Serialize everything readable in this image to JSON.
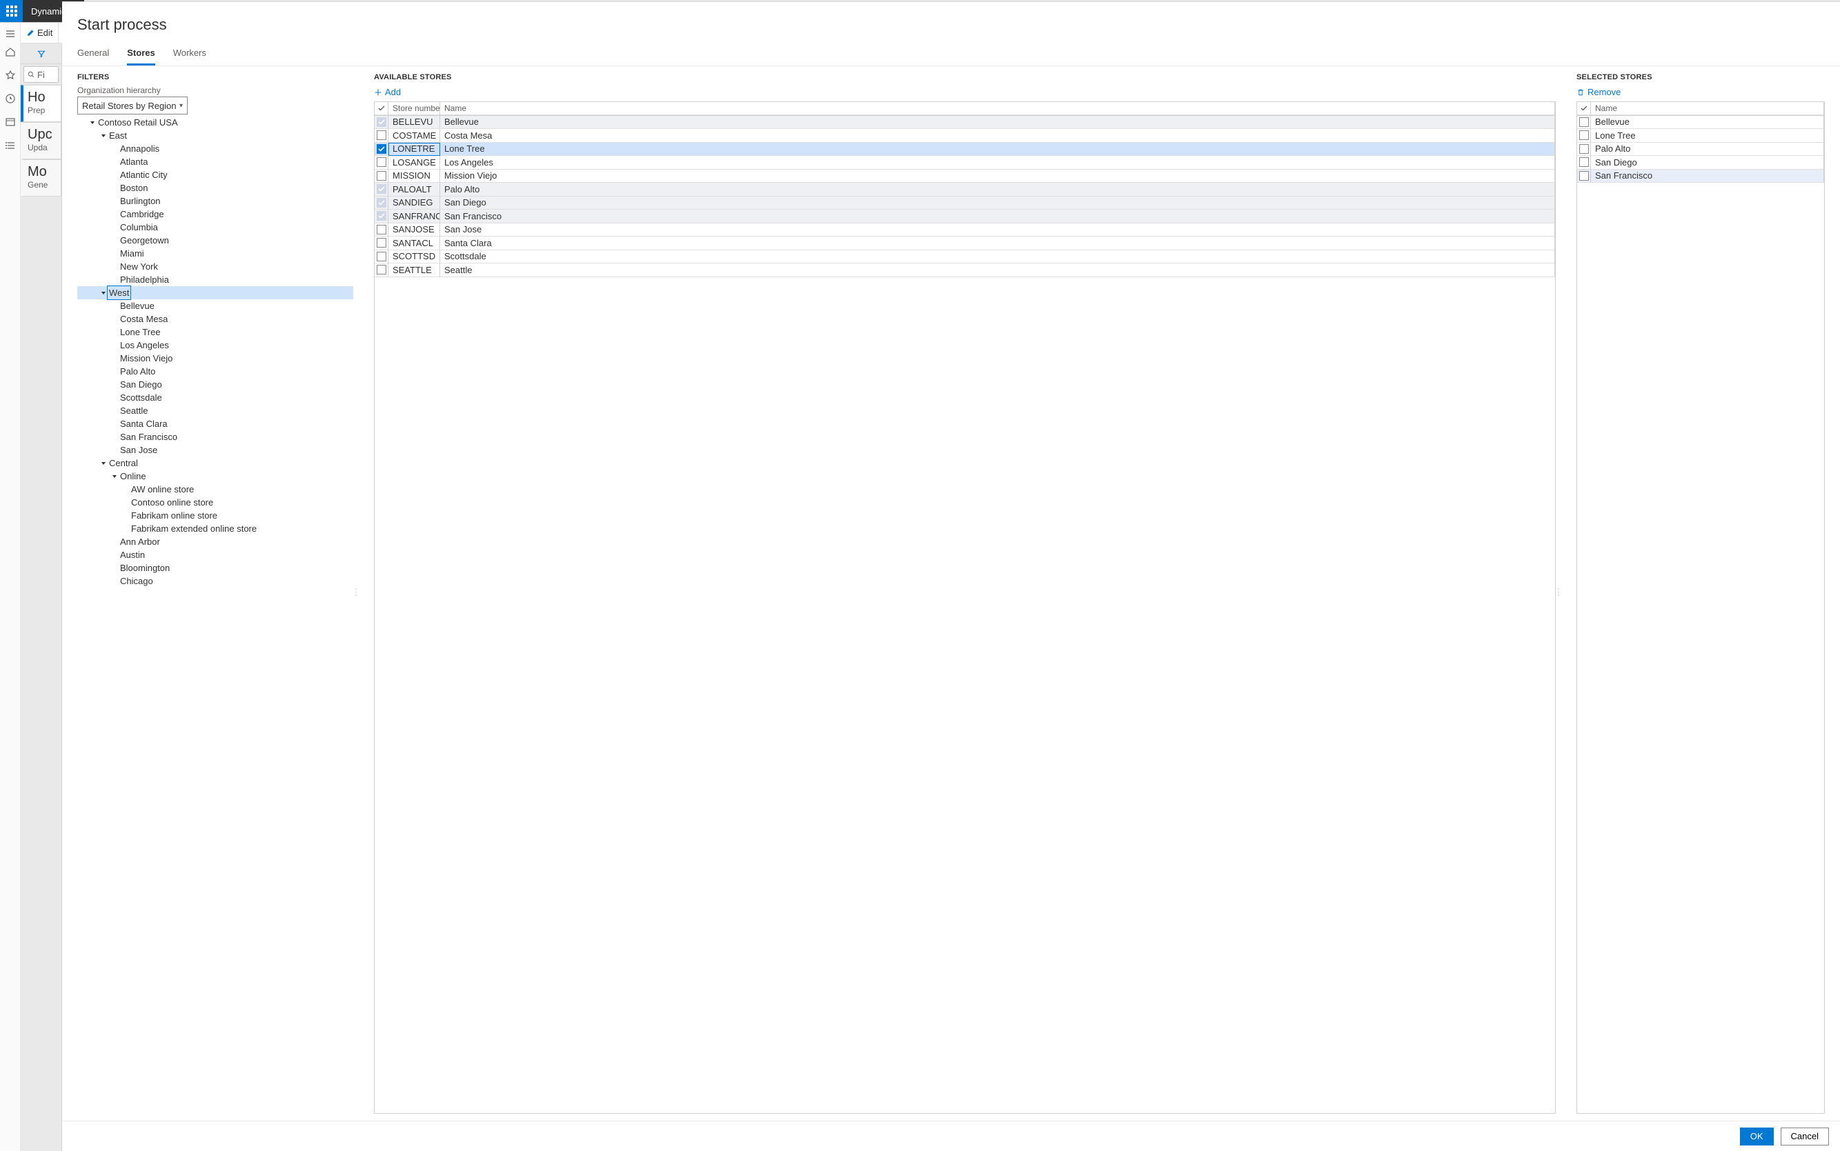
{
  "app": {
    "name": "Dynamics"
  },
  "toolbar": {
    "edit": "Edit"
  },
  "search": {
    "placeholder": "Fi"
  },
  "cards": [
    {
      "big": "Ho",
      "small": "Prep"
    },
    {
      "big": "Upc",
      "small": "Upda"
    },
    {
      "big": "Mo",
      "small": "Gene"
    }
  ],
  "dialog": {
    "title": "Start process",
    "tabs": {
      "general": "General",
      "stores": "Stores",
      "workers": "Workers"
    },
    "filters": {
      "heading": "FILTERS",
      "label": "Organization hierarchy",
      "value": "Retail Stores by Region"
    },
    "tree": [
      {
        "indent": 1,
        "expander": "down",
        "label": "Contoso Retail USA"
      },
      {
        "indent": 2,
        "expander": "down",
        "label": "East"
      },
      {
        "indent": 3,
        "label": "Annapolis"
      },
      {
        "indent": 3,
        "label": "Atlanta"
      },
      {
        "indent": 3,
        "label": "Atlantic City"
      },
      {
        "indent": 3,
        "label": "Boston"
      },
      {
        "indent": 3,
        "label": "Burlington"
      },
      {
        "indent": 3,
        "label": "Cambridge"
      },
      {
        "indent": 3,
        "label": "Columbia"
      },
      {
        "indent": 3,
        "label": "Georgetown"
      },
      {
        "indent": 3,
        "label": "Miami"
      },
      {
        "indent": 3,
        "label": "New York"
      },
      {
        "indent": 3,
        "label": "Philadelphia"
      },
      {
        "indent": 2,
        "expander": "down",
        "label": "West",
        "selected": true
      },
      {
        "indent": 3,
        "label": "Bellevue"
      },
      {
        "indent": 3,
        "label": "Costa Mesa"
      },
      {
        "indent": 3,
        "label": "Lone Tree"
      },
      {
        "indent": 3,
        "label": "Los Angeles"
      },
      {
        "indent": 3,
        "label": "Mission Viejo"
      },
      {
        "indent": 3,
        "label": "Palo Alto"
      },
      {
        "indent": 3,
        "label": "San Diego"
      },
      {
        "indent": 3,
        "label": "Scottsdale"
      },
      {
        "indent": 3,
        "label": "Seattle"
      },
      {
        "indent": 3,
        "label": "Santa Clara"
      },
      {
        "indent": 3,
        "label": "San Francisco"
      },
      {
        "indent": 3,
        "label": "San Jose"
      },
      {
        "indent": 2,
        "expander": "down",
        "label": "Central"
      },
      {
        "indent": 3,
        "expander": "down",
        "label": "Online"
      },
      {
        "indent": 4,
        "label": "AW online store"
      },
      {
        "indent": 4,
        "label": "Contoso online store"
      },
      {
        "indent": 4,
        "label": "Fabrikam online store"
      },
      {
        "indent": 4,
        "label": "Fabrikam extended online store"
      },
      {
        "indent": 3,
        "label": "Ann Arbor"
      },
      {
        "indent": 3,
        "label": "Austin"
      },
      {
        "indent": 3,
        "label": "Bloomington"
      },
      {
        "indent": 3,
        "label": "Chicago"
      }
    ],
    "available": {
      "heading": "AVAILABLE STORES",
      "add": "Add",
      "columns": {
        "number": "Store number",
        "name": "Name"
      },
      "rows": [
        {
          "num": "BELLEVU",
          "name": "Bellevue",
          "state": "soft"
        },
        {
          "num": "COSTAME",
          "name": "Costa Mesa",
          "state": ""
        },
        {
          "num": "LONETRE",
          "name": "Lone Tree",
          "state": "hard"
        },
        {
          "num": "LOSANGE",
          "name": "Los Angeles",
          "state": ""
        },
        {
          "num": "MISSION",
          "name": "Mission Viejo",
          "state": ""
        },
        {
          "num": "PALOALT",
          "name": "Palo Alto",
          "state": "soft"
        },
        {
          "num": "SANDIEG",
          "name": "San Diego",
          "state": "soft"
        },
        {
          "num": "SANFRANCIS",
          "name": "San Francisco",
          "state": "soft"
        },
        {
          "num": "SANJOSE",
          "name": "San Jose",
          "state": ""
        },
        {
          "num": "SANTACL",
          "name": "Santa Clara",
          "state": ""
        },
        {
          "num": "SCOTTSD",
          "name": "Scottsdale",
          "state": ""
        },
        {
          "num": "SEATTLE",
          "name": "Seattle",
          "state": ""
        }
      ]
    },
    "selected": {
      "heading": "SELECTED STORES",
      "remove": "Remove",
      "columns": {
        "name": "Name"
      },
      "rows": [
        {
          "name": "Bellevue",
          "hl": false
        },
        {
          "name": "Lone Tree",
          "hl": false
        },
        {
          "name": "Palo Alto",
          "hl": false
        },
        {
          "name": "San Diego",
          "hl": false
        },
        {
          "name": "San Francisco",
          "hl": true
        }
      ]
    },
    "footer": {
      "ok": "OK",
      "cancel": "Cancel"
    }
  }
}
